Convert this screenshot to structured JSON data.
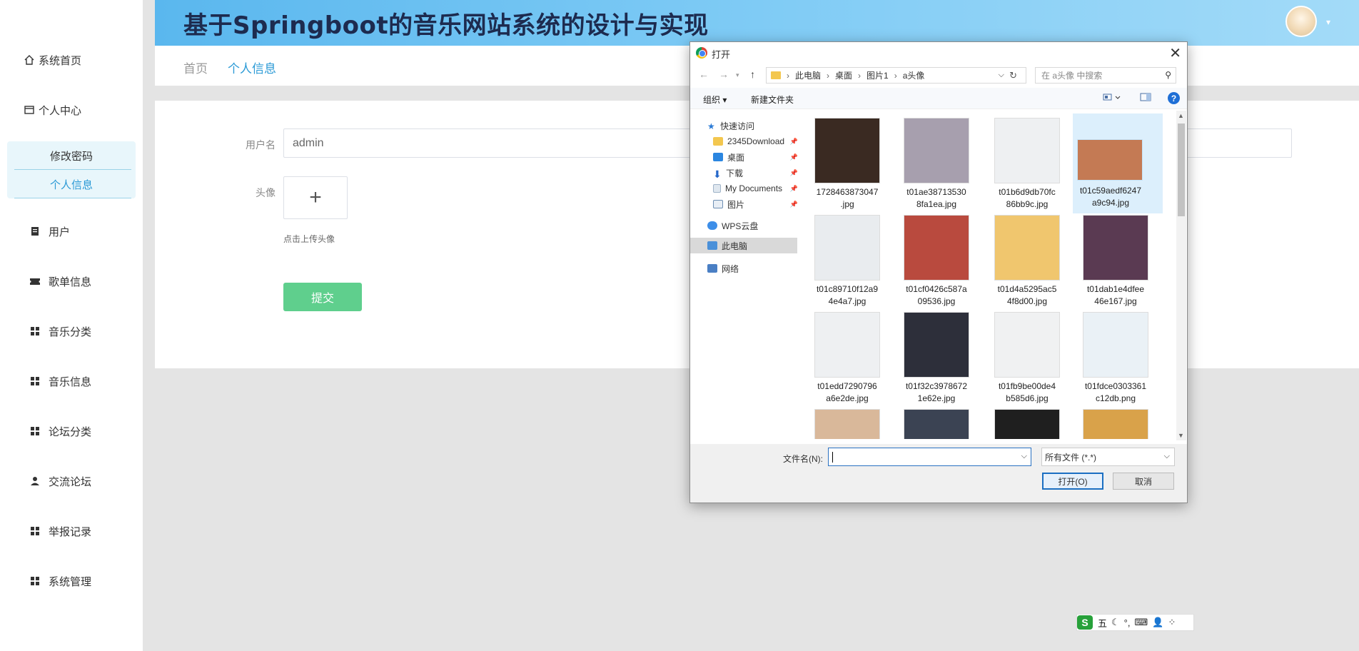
{
  "app": {
    "title": "基于Springboot的音乐网站系统的设计与实现"
  },
  "sidebar": {
    "items": [
      {
        "label": "系统首页",
        "icon": "home-icon"
      },
      {
        "label": "个人中心",
        "icon": "card-icon"
      },
      {
        "label": "用户",
        "icon": "clipboard-icon"
      },
      {
        "label": "歌单信息",
        "icon": "ticket-icon"
      },
      {
        "label": "音乐分类",
        "icon": "grid-icon"
      },
      {
        "label": "音乐信息",
        "icon": "grid-icon"
      },
      {
        "label": "论坛分类",
        "icon": "grid-icon"
      },
      {
        "label": "交流论坛",
        "icon": "user-icon"
      },
      {
        "label": "举报记录",
        "icon": "grid-icon"
      },
      {
        "label": "系统管理",
        "icon": "grid-icon"
      }
    ],
    "submenu": [
      "修改密码",
      "个人信息"
    ]
  },
  "breadcrumb": {
    "home": "首页",
    "current": "个人信息"
  },
  "form": {
    "username_label": "用户名",
    "username_value": "admin",
    "avatar_label": "头像",
    "upload_plus": "+",
    "upload_tip": "点击上传头像",
    "submit_label": "提交"
  },
  "dialog": {
    "title": "打开",
    "close": "✕",
    "path": [
      "此电脑",
      "桌面",
      "图片1",
      "a头像"
    ],
    "search_placeholder": "在 a头像 中搜索",
    "toolbar": {
      "organize": "组织 ▾",
      "new_folder": "新建文件夹",
      "help": "?"
    },
    "tree": [
      {
        "label": "快速访问",
        "color": "#2b7bd6",
        "pinned": false
      },
      {
        "label": "2345Download",
        "color": "#f3c74f",
        "pinned": true
      },
      {
        "label": "桌面",
        "color": "#2b86e0",
        "pinned": true
      },
      {
        "label": "下载",
        "color": "#2467c9",
        "pinned": true
      },
      {
        "label": "My Documents",
        "color": "#9fb3c8",
        "pinned": true
      },
      {
        "label": "图片",
        "color": "#6e8fb3",
        "pinned": true
      },
      {
        "label": "WPS云盘",
        "color": "#3d8ee8",
        "pinned": false
      },
      {
        "label": "此电脑",
        "color": "#4a90d9",
        "pinned": false,
        "selected": true
      },
      {
        "label": "网络",
        "color": "#4a7fc4",
        "pinned": false
      }
    ],
    "files": [
      {
        "name1": "1728463873047",
        "name2": ".jpg",
        "color": "#3a2a22"
      },
      {
        "name1": "t01ae38713530",
        "name2": "8fa1ea.jpg",
        "color": "#a79fae"
      },
      {
        "name1": "t01b6d9db70fc",
        "name2": "86bb9c.jpg",
        "color": "#eef0f2"
      },
      {
        "name1": "t01c59aedf6247",
        "name2": "a9c94.jpg",
        "color": "#c47a54",
        "selected": true
      },
      {
        "name1": "t01c89710f12a9",
        "name2": "4e4a7.jpg",
        "color": "#e9ecef"
      },
      {
        "name1": "t01cf0426c587a",
        "name2": "09536.jpg",
        "color": "#b94a3e"
      },
      {
        "name1": "t01d4a5295ac5",
        "name2": "4f8d00.jpg",
        "color": "#f0c66e"
      },
      {
        "name1": "t01dab1e4dfee",
        "name2": "46e167.jpg",
        "color": "#5a3a52"
      },
      {
        "name1": "t01edd7290796",
        "name2": "a6e2de.jpg",
        "color": "#eef0f2"
      },
      {
        "name1": "t01f32c3978672",
        "name2": "1e62e.jpg",
        "color": "#2d2f3a"
      },
      {
        "name1": "t01fb9be00de4",
        "name2": "b585d6.jpg",
        "color": "#f0f1f2"
      },
      {
        "name1": "t01fdce0303361",
        "name2": "c12db.png",
        "color": "#eaf1f6"
      },
      {
        "name1": "",
        "name2": "",
        "color": "#d9b89a"
      },
      {
        "name1": "",
        "name2": "",
        "color": "#3b4353"
      },
      {
        "name1": "",
        "name2": "",
        "color": "#1f1f1f"
      },
      {
        "name1": "",
        "name2": "",
        "color": "#d9a24a"
      }
    ],
    "filename_label": "文件名(N):",
    "filetype": "所有文件 (*.*)",
    "open_label": "打开(O)",
    "cancel_label": "取消"
  },
  "ime": {
    "logo": "S",
    "items": [
      "五",
      "☾",
      "°,",
      "⌨",
      "👤",
      "⁘"
    ]
  },
  "colors": {
    "accent": "#2b9ad6",
    "submit": "#5fcf8d",
    "header_start": "#5ab7ee",
    "header_end": "#a3dbf8"
  }
}
